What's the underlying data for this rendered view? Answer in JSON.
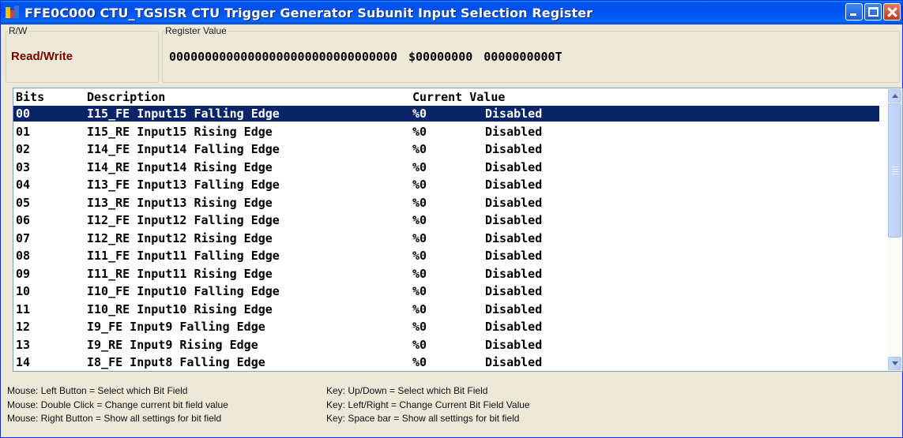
{
  "window": {
    "title": "FFE0C000 CTU_TGSISR CTU Trigger Generator Subunit Input Selection Register",
    "icon": "register-app-icon"
  },
  "rw": {
    "legend": "R/W",
    "value": "Read/Write"
  },
  "register_value": {
    "legend": "Register Value",
    "binary": "00000000000000000000000000000000",
    "hex": "$00000000",
    "decimal": "0000000000T"
  },
  "table": {
    "headers": {
      "bits": "Bits",
      "description": "Description",
      "current": "Current Value"
    },
    "rows": [
      {
        "bits": "00",
        "desc": "I15_FE Input15 Falling Edge",
        "cur": "%0",
        "val": "Disabled",
        "selected": true
      },
      {
        "bits": "01",
        "desc": "I15_RE Input15 Rising Edge",
        "cur": "%0",
        "val": "Disabled"
      },
      {
        "bits": "02",
        "desc": "I14_FE Input14 Falling Edge",
        "cur": "%0",
        "val": "Disabled"
      },
      {
        "bits": "03",
        "desc": "I14_RE Input14 Rising Edge",
        "cur": "%0",
        "val": "Disabled"
      },
      {
        "bits": "04",
        "desc": "I13_FE Input13 Falling Edge",
        "cur": "%0",
        "val": "Disabled"
      },
      {
        "bits": "05",
        "desc": "I13_RE Input13 Rising Edge",
        "cur": "%0",
        "val": "Disabled"
      },
      {
        "bits": "06",
        "desc": "I12_FE Input12 Falling Edge",
        "cur": "%0",
        "val": "Disabled"
      },
      {
        "bits": "07",
        "desc": "I12_RE Input12 Rising Edge",
        "cur": "%0",
        "val": "Disabled"
      },
      {
        "bits": "08",
        "desc": "I11_FE Input11 Falling Edge",
        "cur": "%0",
        "val": "Disabled"
      },
      {
        "bits": "09",
        "desc": "I11_RE Input11 Rising Edge",
        "cur": "%0",
        "val": "Disabled"
      },
      {
        "bits": "10",
        "desc": "I10_FE Input10 Falling Edge",
        "cur": "%0",
        "val": "Disabled"
      },
      {
        "bits": "11",
        "desc": "I10_RE Input10 Rising Edge",
        "cur": "%0",
        "val": "Disabled"
      },
      {
        "bits": "12",
        "desc": "I9_FE Input9 Falling Edge",
        "cur": "%0",
        "val": "Disabled"
      },
      {
        "bits": "13",
        "desc": "I9_RE Input9 Rising Edge",
        "cur": "%0",
        "val": "Disabled"
      },
      {
        "bits": "14",
        "desc": "I8_FE Input8 Falling Edge",
        "cur": "%0",
        "val": "Disabled"
      }
    ]
  },
  "help": {
    "mouse": [
      "Mouse: Left Button = Select which Bit Field",
      "Mouse: Double Click = Change current bit field value",
      "Mouse: Right Button = Show all settings for bit field"
    ],
    "keys": [
      "Key: Up/Down = Select which Bit Field",
      "Key: Left/Right = Change Current Bit Field Value",
      "Key: Space bar = Show all settings for bit field"
    ]
  },
  "colors": {
    "titlebar": "#0054e3",
    "selection": "#0a246a",
    "rw_text": "#7a0000",
    "window_bg": "#ece9d8"
  }
}
